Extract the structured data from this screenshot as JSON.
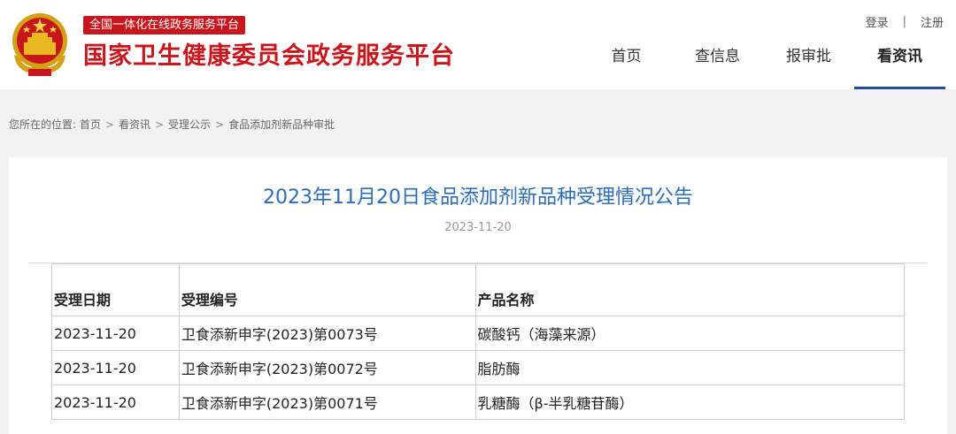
{
  "header": {
    "tagline": "全国一体化在线政务服务平台",
    "site_title": "国家卫生健康委员会政务服务平台",
    "auth": {
      "login": "登录",
      "separator": "|",
      "register": "注册"
    },
    "nav": [
      {
        "label": "首页",
        "active": false
      },
      {
        "label": "查信息",
        "active": false
      },
      {
        "label": "报审批",
        "active": false
      },
      {
        "label": "看资讯",
        "active": true
      }
    ],
    "accent_color": "#c8161d",
    "nav_underline_color": "#1f4e8c"
  },
  "breadcrumb": {
    "prefix": "您所在的位置:",
    "items": [
      "首页",
      "看资讯",
      "受理公示",
      "食品添加剂新品种审批"
    ],
    "separator": ">"
  },
  "article": {
    "title": "2023年11月20日食品添加剂新品种受理情况公告",
    "date": "2023-11-20",
    "title_color": "#2b6cb8",
    "table": {
      "headers": [
        "受理日期",
        "受理编号",
        "产品名称"
      ],
      "rows": [
        [
          "2023-11-20",
          "卫食添新申字(2023)第0073号",
          "碳酸钙（海藻来源）"
        ],
        [
          "2023-11-20",
          "卫食添新申字(2023)第0072号",
          "脂肪酶"
        ],
        [
          "2023-11-20",
          "卫食添新申字(2023)第0071号",
          "乳糖酶（β-半乳糖苷酶）"
        ]
      ]
    }
  }
}
